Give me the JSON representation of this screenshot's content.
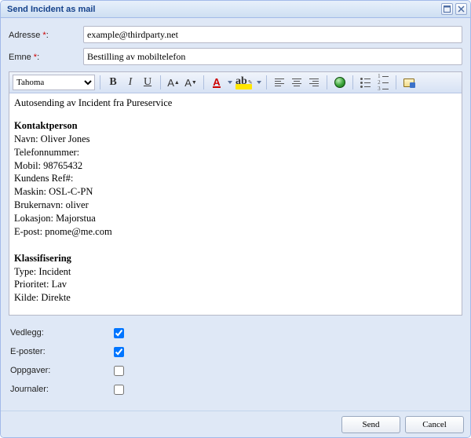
{
  "window": {
    "title": "Send Incident as mail"
  },
  "form": {
    "address_label": "Adresse ",
    "address_value": "example@thirdparty.net",
    "subject_label": "Emne ",
    "subject_value": "Bestilling av mobiltelefon",
    "required_mark": "*"
  },
  "toolbar": {
    "font": "Tahoma"
  },
  "content": {
    "intro": "Autosending av Incident fra Pureservice",
    "contact_header": "Kontaktperson",
    "contact_lines": [
      "Navn: Oliver Jones",
      "Telefonnummer:",
      "Mobil: 98765432",
      "Kundens Ref#:",
      "Maskin: OSL-C-PN",
      "Brukernavn: oliver",
      "Lokasjon: Majorstua",
      "E-post: pnome@me.com"
    ],
    "class_header": "Klassifisering",
    "class_lines": [
      "Type: Incident",
      "Prioritet: Lav",
      "Kilde: Direkte"
    ]
  },
  "checks": {
    "attachments_label": "Vedlegg:",
    "attachments": true,
    "emails_label": "E-poster:",
    "emails": true,
    "tasks_label": "Oppgaver:",
    "tasks": false,
    "journals_label": "Journaler:",
    "journals": false
  },
  "footer": {
    "send_label": "Send",
    "cancel_label": "Cancel"
  }
}
